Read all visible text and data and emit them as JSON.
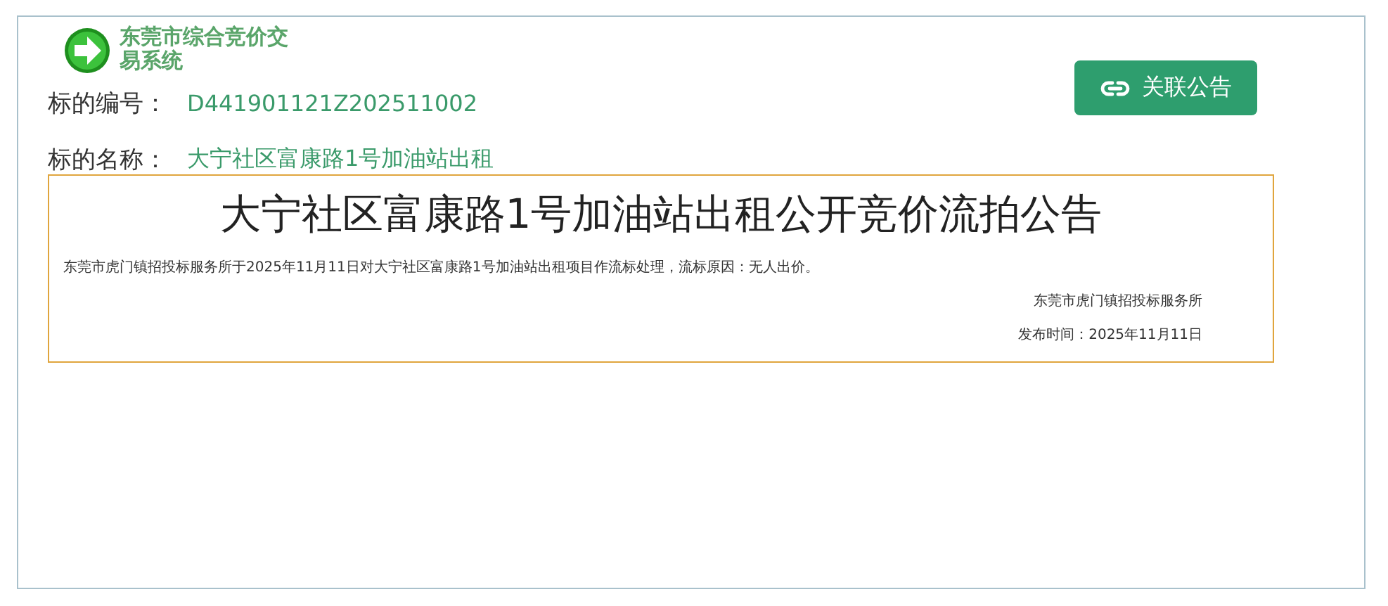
{
  "logo": {
    "title": "东莞市综合竞价交易系统"
  },
  "fields": [
    {
      "label": "标的编号：",
      "value": "D441901121Z202511002"
    },
    {
      "label": "标的名称：",
      "value": "大宁社区富康路1号加油站出租"
    }
  ],
  "button": {
    "label": "关联公告"
  },
  "notice": {
    "title": "大宁社区富康路1号加油站出租公开竞价流拍公告",
    "body": "东莞市虎门镇招投标服务所于2025年11月11日对大宁社区富康路1号加油站出租项目作流标处理，流标原因：无人出价。",
    "issuer": "东莞市虎门镇招投标服务所",
    "date": "发布时间：2025年11月11日"
  }
}
